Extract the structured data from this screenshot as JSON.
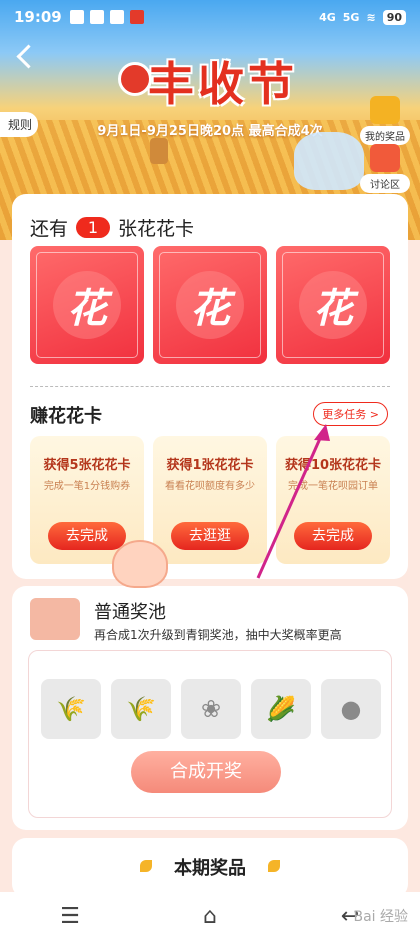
{
  "status_bar": {
    "time": "19:09",
    "network1": "4G",
    "network2": "5G",
    "battery": "90"
  },
  "hero": {
    "title": "丰收节",
    "subtitle": "9月1日-9月25日晚20点 最高合成4次",
    "rules": "规则",
    "my_prizes": "我的奖品",
    "discussion": "讨论区"
  },
  "cards_section": {
    "prefix": "还有",
    "count": "1",
    "suffix": "张花花卡",
    "card_glyph": "花"
  },
  "earn": {
    "title": "赚花花卡",
    "more_tasks": "更多任务 >",
    "tasks": [
      {
        "title": "获得5张花花卡",
        "desc": "完成一笔1分钱购券",
        "button": "去完成"
      },
      {
        "title": "获得1张花花卡",
        "desc": "看看花呗额度有多少",
        "button": "去逛逛"
      },
      {
        "title": "获得10张花花卡",
        "desc": "完成一笔花呗园订单",
        "button": "去完成"
      }
    ]
  },
  "pool": {
    "title": "普通奖池",
    "desc": "再合成1次升级到青铜奖池，抽中大奖概率更高",
    "items": [
      "wheat",
      "rice",
      "sorghum",
      "corn",
      "sweet-potato"
    ],
    "draw_button": "合成开奖"
  },
  "prizes": {
    "title": "本期奖品",
    "progress": 0.33
  },
  "watermark": "Bai 经验",
  "colors": {
    "accent": "#ef2a1d",
    "card_red": "#f1303e",
    "task_bg": "#fde9c2"
  }
}
